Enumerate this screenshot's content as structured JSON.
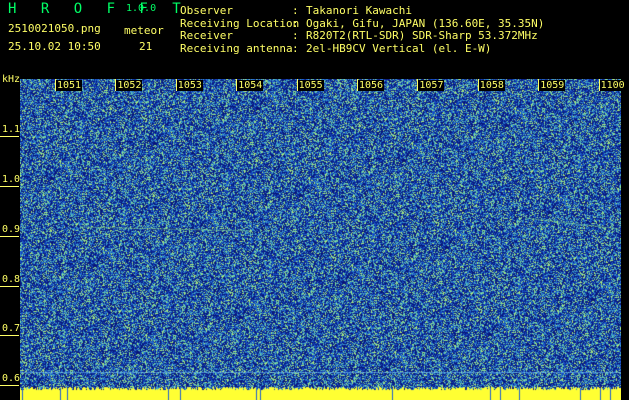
{
  "app": {
    "title": "H R O F F T",
    "version": "1.0.0"
  },
  "capture": {
    "filename": "2510021050.png",
    "timestamp": "25.10.02 10:50",
    "meteor_label": "meteor",
    "meteor_count": "21"
  },
  "info": [
    {
      "key": "Observer",
      "value": "Takanori Kawachi"
    },
    {
      "key": "Receiving Location",
      "value": "Ogaki, Gifu, JAPAN (136.60E, 35.35N)"
    },
    {
      "key": "Receiver",
      "value": "R820T2(RTL-SDR) SDR-Sharp 53.372MHz"
    },
    {
      "key": "Receiving antenna",
      "value": "2el-HB9CV Vertical (el. E-W)"
    }
  ],
  "axis": {
    "y_unit": "kHz",
    "y_ticks": [
      "1.1",
      "1.0",
      "0.9",
      "0.8",
      "0.7",
      "0.6"
    ],
    "x_ticks": [
      "1051",
      "1052",
      "1053",
      "1054",
      "1055",
      "1056",
      "1057",
      "1058",
      "1059",
      "1100"
    ]
  },
  "colors": {
    "text": "#ffff66",
    "title": "#00ff66",
    "noise_base": "#0a2a9a",
    "noise_mid": "#1a5ad0",
    "noise_high": "#3aa0c8",
    "noise_peak": "#7ee0a0",
    "baseline": "#ffff33"
  }
}
